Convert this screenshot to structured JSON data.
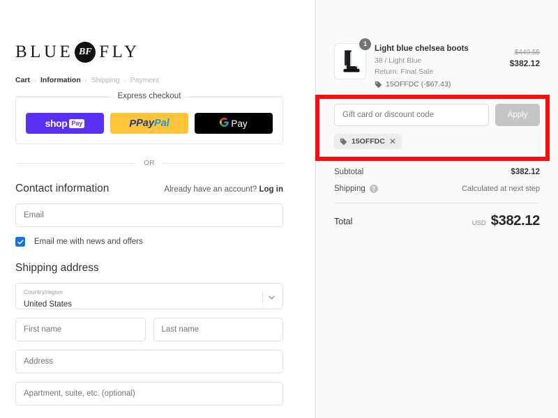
{
  "brand": {
    "name_left": "BLUE",
    "badge": "BF",
    "name_right": "FLY"
  },
  "breadcrumb": [
    {
      "label": "Cart",
      "active": true
    },
    {
      "label": "Information",
      "active": true
    },
    {
      "label": "Shipping",
      "active": false
    },
    {
      "label": "Payment",
      "active": false
    }
  ],
  "separator": "›",
  "express": {
    "title": "Express checkout",
    "buttons": [
      {
        "id": "shop-pay",
        "word": "shop",
        "tag": "Pay"
      },
      {
        "id": "paypal",
        "p": "P",
        "pay": "Pay",
        "pal": "Pal"
      },
      {
        "id": "google-pay",
        "g": "G",
        "pay": "Pay"
      }
    ]
  },
  "or_divider": "OR",
  "contact": {
    "title": "Contact information",
    "account_prompt": "Already have an account?",
    "login_label": "Log in",
    "email_placeholder": "Email",
    "email_value": "",
    "newsletter_label": "Email me with news and offers",
    "newsletter_checked": true
  },
  "shipping": {
    "title": "Shipping address",
    "country_label": "Country/region",
    "country_value": "United States",
    "fields": [
      {
        "name": "first-name",
        "placeholder": "First name",
        "value": ""
      },
      {
        "name": "last-name",
        "placeholder": "Last name",
        "value": ""
      },
      {
        "name": "address",
        "placeholder": "Address",
        "value": ""
      },
      {
        "name": "apartment",
        "placeholder": "Apartment, suite, etc. (optional)",
        "value": ""
      }
    ]
  },
  "order": {
    "product": {
      "name": "Light blue chelsea boots",
      "variant": "38 / Light Blue",
      "return_policy": "Return: Final Sale",
      "discount_line": "15OFFDC (-$67.43)",
      "quantity": "1",
      "price_original": "$449.55",
      "price_final": "$382.12"
    },
    "discount": {
      "placeholder": "Gift card or discount code",
      "value": "",
      "apply_label": "Apply",
      "applied_code": "15OFFDC",
      "remove_label": "✕"
    },
    "totals": {
      "subtotal_label": "Subtotal",
      "subtotal_value": "$382.12",
      "shipping_label": "Shipping",
      "shipping_value": "Calculated at next step",
      "help_glyph": "?",
      "total_label": "Total",
      "currency": "USD",
      "total_value": "$382.12"
    }
  },
  "colors": {
    "shop_pay": "#5a31f4",
    "paypal": "#ffc43a",
    "gpay": "#000000",
    "checkbox": "#1773e0",
    "annotation": "#fb0d0d",
    "sidebar_bg": "#fafafa"
  }
}
